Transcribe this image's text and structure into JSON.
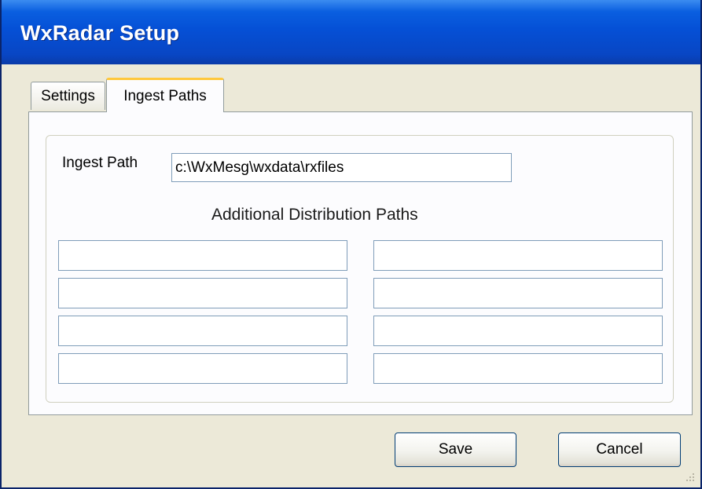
{
  "window": {
    "title": "WxRadar Setup"
  },
  "tabs": [
    {
      "label": "Settings",
      "active": false
    },
    {
      "label": "Ingest Paths",
      "active": true
    }
  ],
  "ingest": {
    "label": "Ingest Path",
    "value": "c:\\WxMesg\\wxdata\\rxfiles"
  },
  "distribution": {
    "heading": "Additional Distribution Paths",
    "paths": [
      "",
      "",
      "",
      "",
      "",
      "",
      "",
      ""
    ]
  },
  "buttons": {
    "save_label": "Save",
    "cancel_label": "Cancel"
  }
}
